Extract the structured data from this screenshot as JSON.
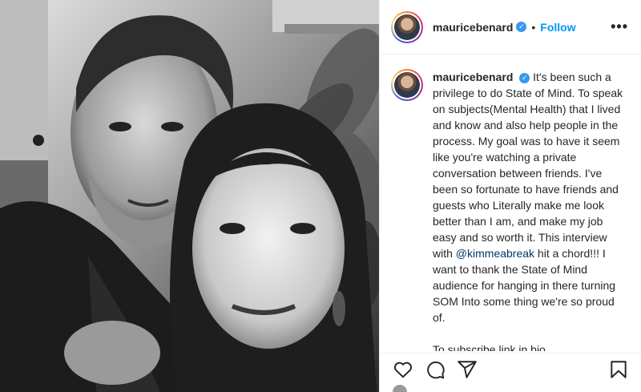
{
  "post": {
    "username": "mauricebenard",
    "follow_label": "Follow",
    "separator": "•",
    "more_label": "•••",
    "verified_glyph": "✓"
  },
  "caption": {
    "username": "mauricebenard",
    "body": "It's been such a privilege to do State of Mind. To speak on subjects(Mental Health) that I lived and know and also help people in the process. My goal was to have it seem like you're watching a private conversation between friends. I've been so fortunate to have friends and guests who Literally make me look better than I am, and make my job easy and so worth it. This interview with ",
    "mention": "@kimmeabreak",
    "body_after": " hit a chord!!! I want to thank the State of Mind audience for hanging in there turning SOM Into some thing we're so proud of.",
    "footer": "To subscribe link in bio"
  },
  "actions": {
    "like_icon": "heart-icon",
    "comment_icon": "comment-icon",
    "share_icon": "share-icon",
    "save_icon": "bookmark-icon"
  },
  "colors": {
    "accent": "#0095f6",
    "verified": "#3897f0",
    "mention": "#00376b",
    "text": "#262626",
    "border": "#efefef"
  }
}
